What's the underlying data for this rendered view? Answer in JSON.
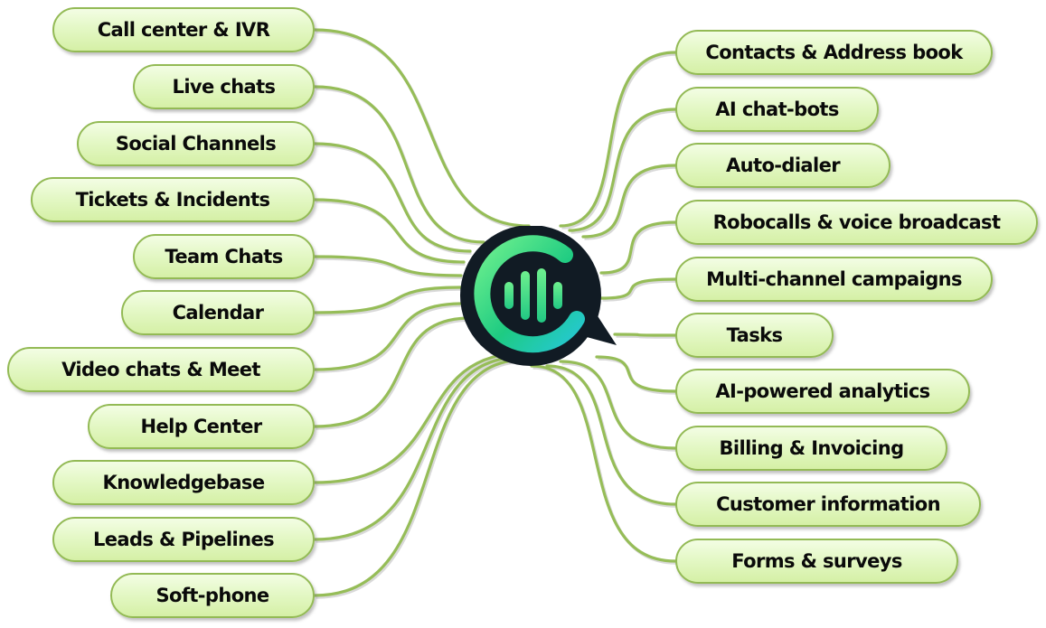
{
  "diagram": {
    "type": "mind-map",
    "center": {
      "name": "logo",
      "icon": "chat-bubble-soundwave-logo"
    },
    "colors": {
      "node_fill": "#e4f8c6",
      "node_border": "#93ba55",
      "connector": "#96bd58",
      "logo_bg": "#111b24",
      "logo_green": "#6ef08e",
      "logo_teal": "#25c8d4",
      "text": "#0a0a0a"
    },
    "left_branches": [
      {
        "label": "Call center & IVR"
      },
      {
        "label": "Live chats"
      },
      {
        "label": "Social Channels"
      },
      {
        "label": "Tickets & Incidents"
      },
      {
        "label": "Team Chats"
      },
      {
        "label": "Calendar"
      },
      {
        "label": "Video chats & Meet"
      },
      {
        "label": "Help Center"
      },
      {
        "label": "Knowledgebase"
      },
      {
        "label": "Leads & Pipelines"
      },
      {
        "label": "Soft-phone"
      }
    ],
    "right_branches": [
      {
        "label": "Contacts & Address book"
      },
      {
        "label": "AI chat-bots"
      },
      {
        "label": "Auto-dialer"
      },
      {
        "label": "Robocalls & voice broadcast"
      },
      {
        "label": "Multi-channel campaigns"
      },
      {
        "label": "Tasks"
      },
      {
        "label": "AI-powered analytics"
      },
      {
        "label": "Billing & Invoicing"
      },
      {
        "label": "Customer information"
      },
      {
        "label": "Forms & surveys"
      }
    ]
  }
}
